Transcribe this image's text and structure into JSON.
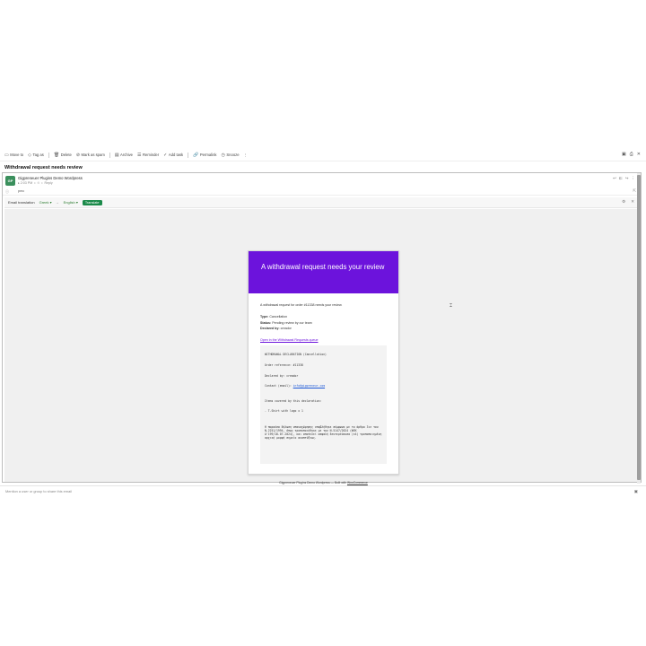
{
  "toolbar": {
    "items": [
      {
        "icon": "move-icon",
        "label": "Move to"
      },
      {
        "icon": "tag-icon",
        "label": "Tag as"
      },
      {
        "icon": "trash-icon",
        "label": "Delete"
      },
      {
        "icon": "spam-icon",
        "label": "Mark as spam"
      },
      {
        "icon": "archive-icon",
        "label": "Archive"
      },
      {
        "icon": "reminder-icon",
        "label": "Reminder"
      },
      {
        "icon": "task-icon",
        "label": "Add task"
      },
      {
        "icon": "link-icon",
        "label": "Permalink"
      },
      {
        "icon": "snooze-icon",
        "label": "Snooze"
      }
    ],
    "more": "⋮"
  },
  "subject": "Withdrawal request needs review",
  "sender": {
    "avatar": "GP",
    "name": "Gigpreneuer Plugins Demo Wordpress",
    "meta": [
      "▸ 2:03 PM",
      "•",
      "⏲",
      "•",
      "Reply"
    ]
  },
  "recipient": "pmc",
  "translate": {
    "label": "Email translation",
    "from_lang": "Greek",
    "to_lang": "English",
    "button": "Translate"
  },
  "email": {
    "heading": "A withdrawal request needs your review",
    "intro": "A withdrawal request for order #11338 needs your review.",
    "type_label": "Type:",
    "type_value": "Cancellation",
    "status_label": "Status:",
    "status_value": "Pending review by our team",
    "declared_label": "Declared by:",
    "declared_value": "creador",
    "queue_link": "Open in the Withdrawal Requests queue",
    "declaration": {
      "title": "WITHDRAWAL DECLARATION (Cancellation)",
      "order_ref": "Order reference: #11338",
      "declared": "Declared by: creador",
      "contact_label": "Contact (email): ",
      "contact_email": "info@gigpreneur.com",
      "items_label": "Items covered by this declaration:",
      "item": "- T-Shirt with logo x 1",
      "greek": "Η παρούσα δήλωση υπαναχώρησης υποβλήθηκε σύμφωνα με το άρθρο 3ιε του Ν.2251/1994, όπως τροποποιήθηκε με τον Ν.5147/2024 (ΦΕΚ Α'199/18.07.2024), και αποτελεί ασφαλή δευτερεύουσα (ε4) τροποποιημένη αρχική μορφή σημείο αναπτύξεως."
    },
    "footer_text": "Gigpreneuer Plugins Demo Wordpress — Built with ",
    "footer_link": "WooCommerce"
  },
  "share": {
    "placeholder": "Mention a user or group to share this email"
  }
}
